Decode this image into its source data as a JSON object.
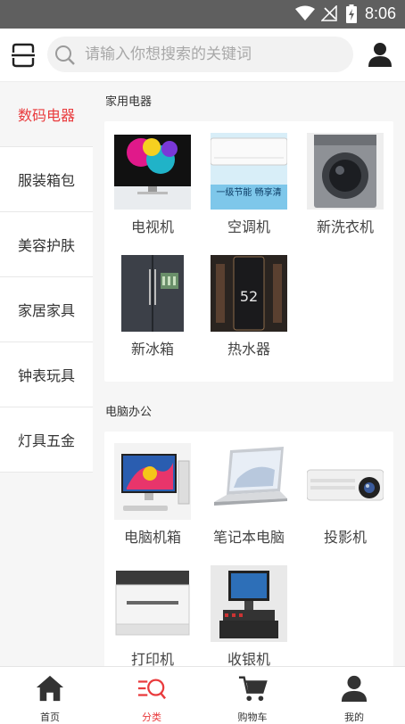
{
  "status_bar": {
    "time": "8:06",
    "icons": [
      "wifi-icon",
      "no-signal-icon",
      "battery-charging-icon"
    ]
  },
  "header": {
    "scan_icon": "scan-icon",
    "search_placeholder": "请输入你想搜索的关键词",
    "user_icon": "user-icon"
  },
  "sidebar": {
    "items": [
      {
        "label": "数码电器",
        "active": true
      },
      {
        "label": "服装箱包",
        "active": false
      },
      {
        "label": "美容护肤",
        "active": false
      },
      {
        "label": "家居家具",
        "active": false
      },
      {
        "label": "钟表玩具",
        "active": false
      },
      {
        "label": "灯具五金",
        "active": false
      }
    ]
  },
  "sections": [
    {
      "title": "家用电器",
      "products": [
        {
          "label": "电视机",
          "image": "tv-image"
        },
        {
          "label": "空调机",
          "image": "air-conditioner-image",
          "image_text": "一级节能 畅享清"
        },
        {
          "label": "新洗衣机",
          "image": "washing-machine-image"
        },
        {
          "label": "新冰箱",
          "image": "refrigerator-image"
        },
        {
          "label": "热水器",
          "image": "water-heater-image",
          "image_text": "52"
        }
      ]
    },
    {
      "title": "电脑办公",
      "products": [
        {
          "label": "电脑机箱",
          "image": "desktop-computer-image"
        },
        {
          "label": "笔记本电脑",
          "image": "laptop-image"
        },
        {
          "label": "投影机",
          "image": "projector-image"
        },
        {
          "label": "打印机",
          "image": "printer-image"
        },
        {
          "label": "收银机",
          "image": "cash-register-image"
        }
      ]
    }
  ],
  "tab_bar": {
    "tabs": [
      {
        "label": "首页",
        "icon": "home-icon",
        "active": false
      },
      {
        "label": "分类",
        "icon": "category-icon",
        "active": true
      },
      {
        "label": "购物车",
        "icon": "cart-icon",
        "active": false
      },
      {
        "label": "我的",
        "icon": "profile-icon",
        "active": false
      }
    ]
  },
  "colors": {
    "accent": "#e93b3d",
    "status_bar": "#5f5f5f",
    "background": "#f6f6f6"
  }
}
